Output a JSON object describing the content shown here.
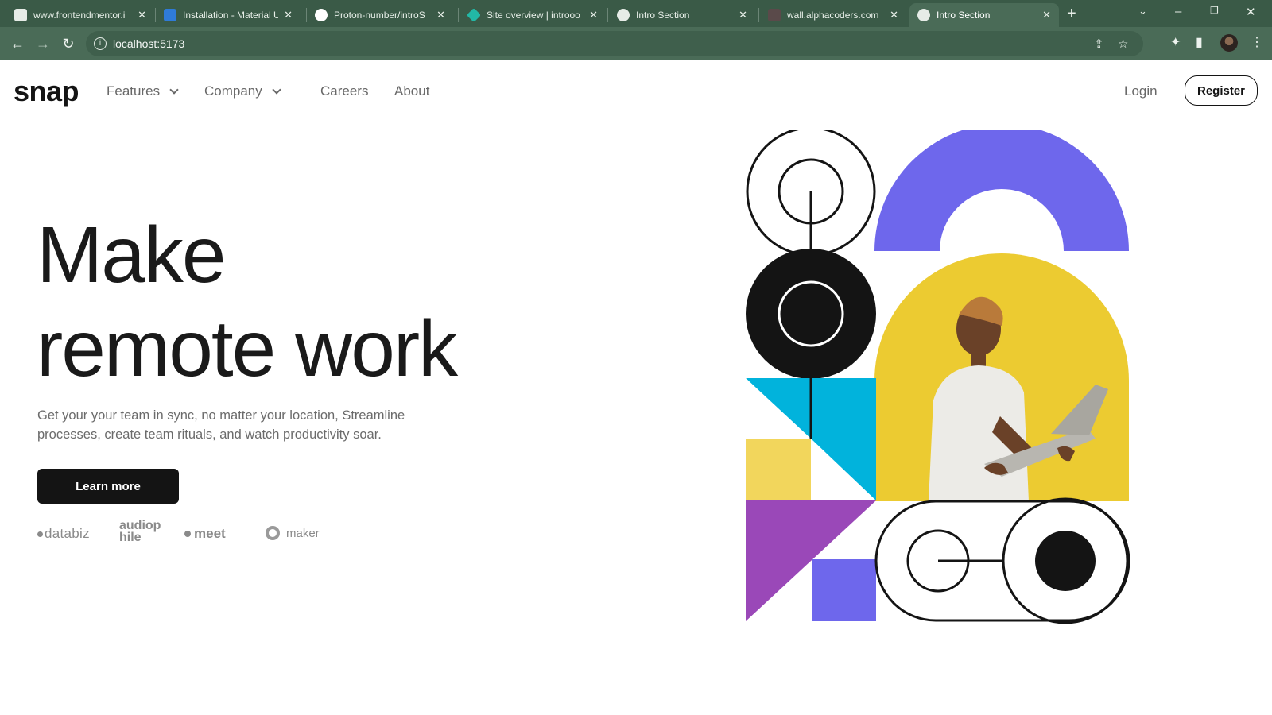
{
  "browser": {
    "tabs": [
      {
        "title": "www.frontendmentor.i",
        "icon": "frontendmentor-favicon"
      },
      {
        "title": "Installation - Material U",
        "icon": "mui-favicon"
      },
      {
        "title": "Proton-number/introS",
        "icon": "github-icon"
      },
      {
        "title": "Site overview | introoo",
        "icon": "netlify-icon"
      },
      {
        "title": "Intro Section",
        "icon": "globe-favicon"
      },
      {
        "title": "wall.alphacoders.com",
        "icon": "alphacoders-favicon"
      },
      {
        "title": "Intro Section",
        "icon": "globe-favicon",
        "active": true
      }
    ],
    "url": "localhost:5173"
  },
  "site": {
    "logo": "snap",
    "nav": {
      "features": "Features",
      "company": "Company",
      "careers": "Careers",
      "about": "About"
    },
    "auth": {
      "login": "Login",
      "register": "Register"
    },
    "hero": {
      "line1": "Make",
      "line2": "remote work",
      "description": "Get your your team in sync, no matter your location, Streamline processes, create team rituals, and watch productivity soar.",
      "cta": "Learn more"
    },
    "clients": [
      "databiz",
      "audiophile",
      "meet",
      "maker"
    ]
  },
  "colors": {
    "purple": "#6e67ec",
    "yellow": "#eccb31",
    "cyan": "#01b3dc",
    "pale_yellow": "#f2d65c",
    "magenta": "#9a48b8",
    "dark": "#141414"
  }
}
